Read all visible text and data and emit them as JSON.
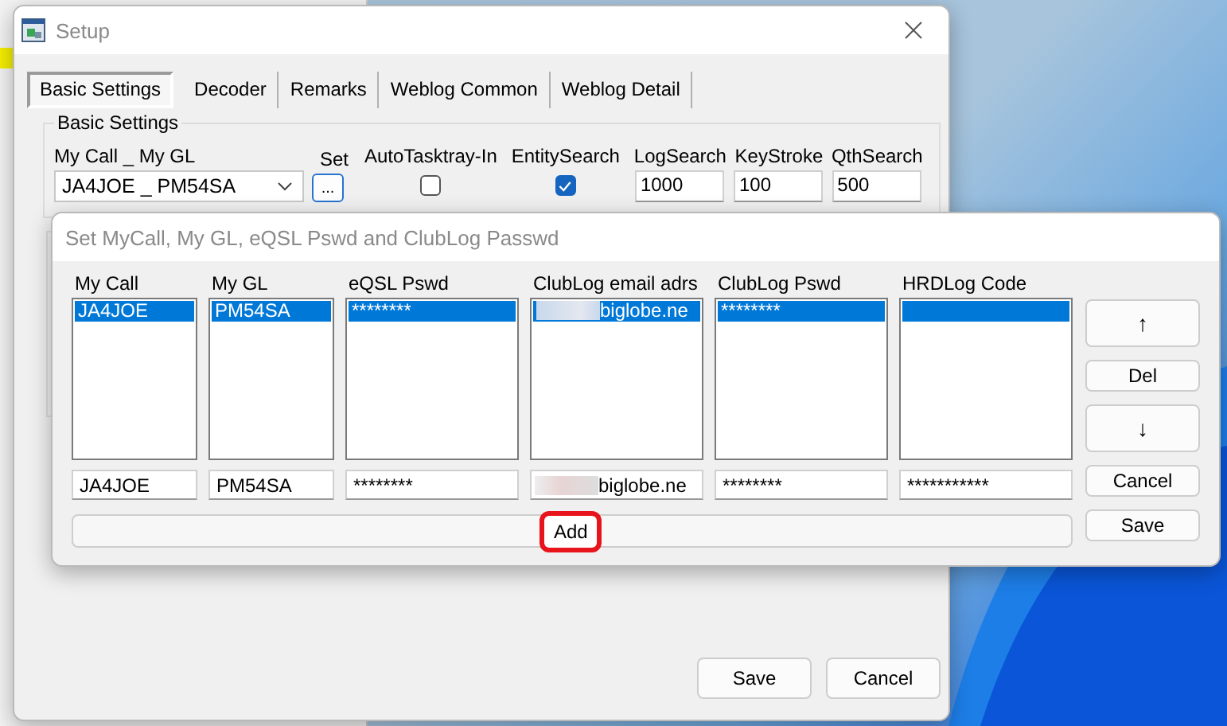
{
  "setup_window": {
    "title": "Setup",
    "tabs": [
      {
        "label": "Basic Settings",
        "selected": true
      },
      {
        "label": "Decoder",
        "selected": false
      },
      {
        "label": "Remarks",
        "selected": false
      },
      {
        "label": "Weblog Common",
        "selected": false
      },
      {
        "label": "Weblog Detail",
        "selected": false
      }
    ],
    "group": {
      "title": "Basic Settings",
      "fields": [
        {
          "kind": "combo",
          "label": "My Call _ My GL",
          "value": "JA4JOE _ PM54SA"
        },
        {
          "kind": "button",
          "label": "Set",
          "button": "..."
        },
        {
          "kind": "checkbox",
          "label": "AutoTasktray-In",
          "checked": false
        },
        {
          "kind": "checkbox",
          "label": "EntitySearch",
          "checked": true
        },
        {
          "kind": "text",
          "label": "LogSearch",
          "value": "1000"
        },
        {
          "kind": "text",
          "label": "KeyStroke",
          "value": "100"
        },
        {
          "kind": "text",
          "label": "QthSearch",
          "value": "500"
        }
      ]
    },
    "buttons": [
      "Save",
      "Cancel"
    ]
  },
  "dialog": {
    "title": "Set MyCall, My GL, eQSL Pswd and ClubLog Passwd",
    "columns": [
      {
        "label": "My Call",
        "items": [
          {
            "text": "JA4JOE",
            "selected": true
          }
        ],
        "input": "JA4JOE"
      },
      {
        "label": "My GL",
        "items": [
          {
            "text": "PM54SA",
            "selected": true
          }
        ],
        "input": "PM54SA"
      },
      {
        "label": "eQSL Pswd",
        "items": [
          {
            "text": "********",
            "selected": true
          }
        ],
        "input": "********"
      },
      {
        "label": "ClubLog email adrs",
        "items": [
          {
            "text": "biglobe.ne",
            "selected": true,
            "redacted": true
          }
        ],
        "input": "biglobe.ne",
        "input_redacted": true
      },
      {
        "label": "ClubLog Pswd",
        "items": [
          {
            "text": "********",
            "selected": true
          }
        ],
        "input": "********"
      },
      {
        "label": "HRDLog Code",
        "items": [
          {
            "selected": true
          }
        ],
        "input": "***********"
      }
    ],
    "add_button": {
      "label": "Add",
      "highlighted": true
    },
    "side_buttons": [
      "↑",
      "Del",
      "↓",
      "Cancel",
      "Save"
    ]
  }
}
